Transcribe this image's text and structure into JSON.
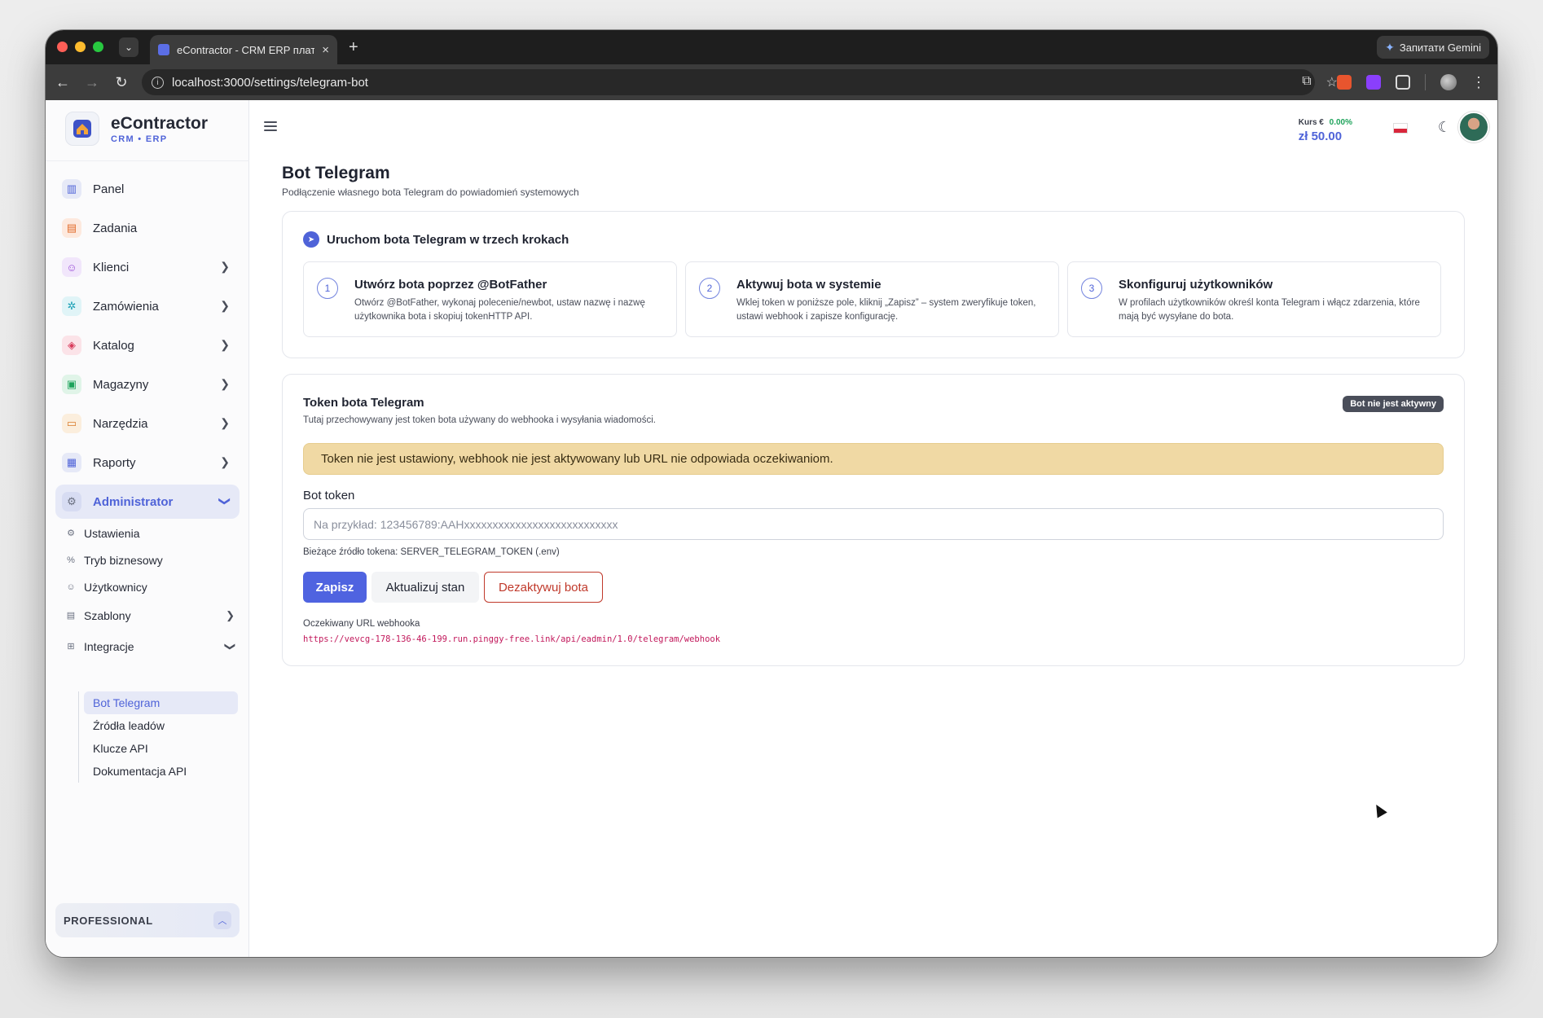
{
  "browser": {
    "tab_title": "eContractor - CRM ERP плат",
    "tab_close": "×",
    "new_tab": "+",
    "gemini_label": "Запитати Gemini",
    "url": "localhost:3000/settings/telegram-bot"
  },
  "brand": {
    "name": "eContractor",
    "sub": "CRM • ERP"
  },
  "nav": {
    "items": [
      {
        "label": "Panel",
        "icon": "chart-icon",
        "color": "#4f63d8"
      },
      {
        "label": "Zadania",
        "icon": "clipboard-icon",
        "color": "#e26b2a"
      },
      {
        "label": "Klienci",
        "icon": "users-icon",
        "color": "#9b4fd8"
      },
      {
        "label": "Zamówienia",
        "icon": "gear-icon",
        "color": "#1a9fb5"
      },
      {
        "label": "Katalog",
        "icon": "box-icon",
        "color": "#d83a5a"
      },
      {
        "label": "Magazyny",
        "icon": "warehouse-icon",
        "color": "#1ea35b"
      },
      {
        "label": "Narzędzia",
        "icon": "toolbox-icon",
        "color": "#d87a2a"
      },
      {
        "label": "Raporty",
        "icon": "report-icon",
        "color": "#4f63d8"
      },
      {
        "label": "Administrator",
        "icon": "admin-gear-icon",
        "color": "#6a7080"
      }
    ],
    "admin_sub": [
      {
        "label": "Ustawienia"
      },
      {
        "label": "Tryb biznesowy"
      },
      {
        "label": "Użytkownicy"
      },
      {
        "label": "Szablony"
      },
      {
        "label": "Integracje"
      }
    ],
    "integrations_sub": [
      {
        "label": "Bot Telegram"
      },
      {
        "label": "Źródła leadów"
      },
      {
        "label": "Klucze API"
      },
      {
        "label": "Dokumentacja API"
      }
    ],
    "plan": "PROFESSIONAL"
  },
  "header": {
    "rate_label": "Kurs €",
    "rate_change": "0.00%",
    "rate_value": "zł 50.00"
  },
  "page": {
    "title": "Bot Telegram",
    "subtitle": "Podłączenie własnego bota Telegram do powiadomień systemowych"
  },
  "steps": {
    "title": "Uruchom bota Telegram w trzech krokach",
    "items": [
      {
        "num": "1",
        "title": "Utwórz bota poprzez @BotFather",
        "desc": "Otwórz @BotFather, wykonaj polecenie/newbot, ustaw nazwę i nazwę użytkownika bota i skopiuj tokenHTTP API."
      },
      {
        "num": "2",
        "title": "Aktywuj bota w systemie",
        "desc": "Wklej token w poniższe pole, kliknij „Zapisz” – system zweryfikuje token, ustawi webhook i zapisze konfigurację."
      },
      {
        "num": "3",
        "title": "Skonfiguruj użytkowników",
        "desc": "W profilach użytkowników określ konta Telegram i włącz zdarzenia, które mają być wysyłane do bota."
      }
    ]
  },
  "token": {
    "title": "Token bota Telegram",
    "desc": "Tutaj przechowywany jest token bota używany do webhooka i wysyłania wiadomości.",
    "badge": "Bot nie jest aktywny",
    "alert": "Token nie jest ustawiony, webhook nie jest aktywowany lub URL nie odpowiada oczekiwaniom.",
    "field_label": "Bot token",
    "placeholder": "Na przykład: 123456789:AAHxxxxxxxxxxxxxxxxxxxxxxxxxxx",
    "source_note": "Bieżące źródło tokena: SERVER_TELEGRAM_TOKEN (.env)",
    "save": "Zapisz",
    "refresh": "Aktualizuj stan",
    "deactivate": "Dezaktywuj bota",
    "webhook_label": "Oczekiwany URL webhooka",
    "webhook_url": "https://vevcg-178-136-46-199.run.pinggy-free.link/api/eadmin/1.0/telegram/webhook"
  }
}
